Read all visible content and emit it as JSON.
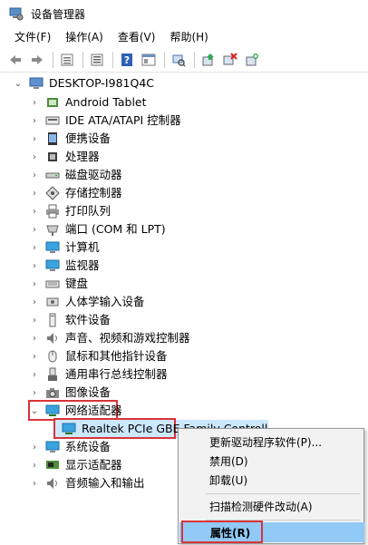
{
  "window": {
    "title": "设备管理器"
  },
  "menu": [
    "文件(F)",
    "操作(A)",
    "查看(V)",
    "帮助(H)"
  ],
  "toolbar_icons": [
    "back-arrow-icon",
    "forward-arrow-icon",
    "properties-grid-icon",
    "list-icon",
    "help-icon",
    "view-icon",
    "scan-icon",
    "update-driver-icon",
    "uninstall-icon",
    "add-hardware-icon"
  ],
  "tree": {
    "root": "DESKTOP-I981Q4C",
    "items": [
      {
        "label": "Android Tablet",
        "icon": "android-device-icon",
        "expanded": false
      },
      {
        "label": "IDE ATA/ATAPI 控制器",
        "icon": "ide-controller-icon",
        "expanded": false
      },
      {
        "label": "便携设备",
        "icon": "portable-device-icon",
        "expanded": false
      },
      {
        "label": "处理器",
        "icon": "processor-icon",
        "expanded": false
      },
      {
        "label": "磁盘驱动器",
        "icon": "disk-drive-icon",
        "expanded": false
      },
      {
        "label": "存储控制器",
        "icon": "storage-controller-icon",
        "expanded": false
      },
      {
        "label": "打印队列",
        "icon": "printer-icon",
        "expanded": false
      },
      {
        "label": "端口 (COM 和 LPT)",
        "icon": "port-icon",
        "expanded": false
      },
      {
        "label": "计算机",
        "icon": "computer-icon",
        "expanded": false
      },
      {
        "label": "监视器",
        "icon": "monitor-icon",
        "expanded": false
      },
      {
        "label": "键盘",
        "icon": "keyboard-icon",
        "expanded": false
      },
      {
        "label": "人体学输入设备",
        "icon": "hid-icon",
        "expanded": false
      },
      {
        "label": "软件设备",
        "icon": "software-device-icon",
        "expanded": false
      },
      {
        "label": "声音、视频和游戏控制器",
        "icon": "sound-icon",
        "expanded": false
      },
      {
        "label": "鼠标和其他指针设备",
        "icon": "mouse-icon",
        "expanded": false
      },
      {
        "label": "通用串行总线控制器",
        "icon": "usb-icon",
        "expanded": false
      },
      {
        "label": "图像设备",
        "icon": "camera-icon",
        "expanded": false
      },
      {
        "label": "网络适配器",
        "icon": "network-adapter-icon",
        "expanded": true
      },
      {
        "label": "Realtek PCIe GBE Family Controller",
        "icon": "network-card-icon",
        "child": true
      },
      {
        "label": "系统设备",
        "icon": "system-device-icon",
        "expanded": false
      },
      {
        "label": "显示适配器",
        "icon": "display-adapter-icon",
        "expanded": false
      },
      {
        "label": "音频输入和输出",
        "icon": "audio-io-icon",
        "expanded": false
      }
    ]
  },
  "context_menu": {
    "items": [
      {
        "label": "更新驱动程序软件(P)..."
      },
      {
        "label": "禁用(D)"
      },
      {
        "label": "卸载(U)"
      },
      {
        "label": "扫描检测硬件改动(A)"
      },
      {
        "label": "属性(R)"
      }
    ]
  },
  "colors": {
    "highlight_box": "#d9333a",
    "selection": "#cce8ff",
    "menu_hover": "#91c9f7"
  }
}
